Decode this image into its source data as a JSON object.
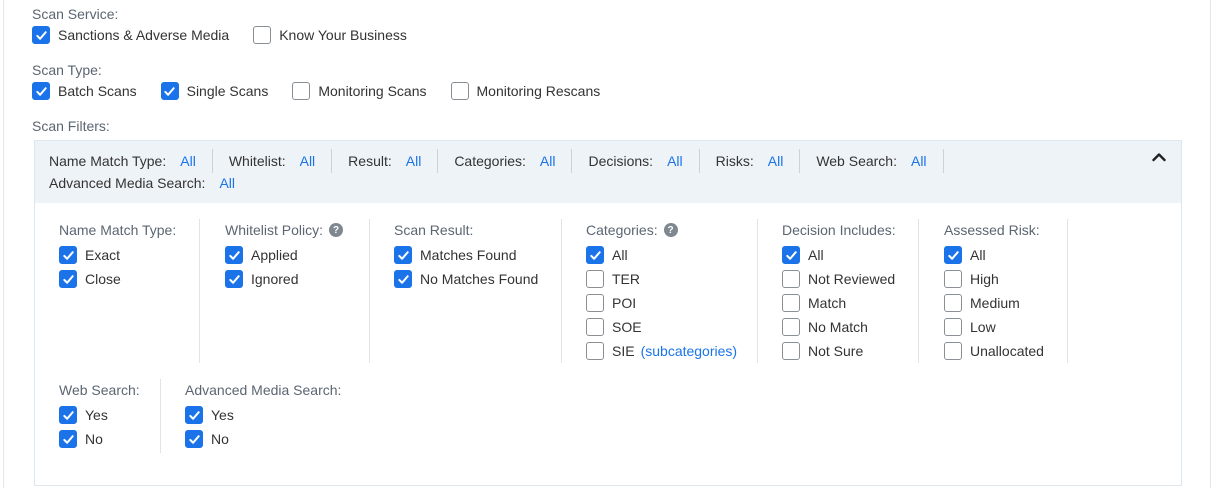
{
  "scan_service": {
    "label": "Scan Service:",
    "options": [
      {
        "label": "Sanctions & Adverse Media",
        "checked": true
      },
      {
        "label": "Know Your Business",
        "checked": false
      }
    ]
  },
  "scan_type": {
    "label": "Scan Type:",
    "options": [
      {
        "label": "Batch Scans",
        "checked": true
      },
      {
        "label": "Single Scans",
        "checked": true
      },
      {
        "label": "Monitoring Scans",
        "checked": false
      },
      {
        "label": "Monitoring Rescans",
        "checked": false
      }
    ]
  },
  "scan_filters": {
    "label": "Scan Filters:",
    "summary": [
      {
        "key": "Name Match Type:",
        "value": "All"
      },
      {
        "key": "Whitelist:",
        "value": "All"
      },
      {
        "key": "Result:",
        "value": "All"
      },
      {
        "key": "Categories:",
        "value": "All"
      },
      {
        "key": "Decisions:",
        "value": "All"
      },
      {
        "key": "Risks:",
        "value": "All"
      },
      {
        "key": "Web Search:",
        "value": "All"
      }
    ],
    "summary_line2": [
      {
        "key": "Advanced Media Search:",
        "value": "All"
      }
    ],
    "groups": {
      "name_match_type": {
        "title": "Name Match Type:",
        "options": [
          {
            "label": "Exact",
            "checked": true
          },
          {
            "label": "Close",
            "checked": true
          }
        ]
      },
      "whitelist_policy": {
        "title": "Whitelist Policy:",
        "help": "?",
        "options": [
          {
            "label": "Applied",
            "checked": true
          },
          {
            "label": "Ignored",
            "checked": true
          }
        ]
      },
      "scan_result": {
        "title": "Scan Result:",
        "options": [
          {
            "label": "Matches Found",
            "checked": true
          },
          {
            "label": "No Matches Found",
            "checked": true
          }
        ]
      },
      "categories": {
        "title": "Categories:",
        "help": "?",
        "options": [
          {
            "label": "All",
            "checked": true
          },
          {
            "label": "TER",
            "checked": false
          },
          {
            "label": "POI",
            "checked": false
          },
          {
            "label": "SOE",
            "checked": false
          },
          {
            "label": "SIE",
            "checked": false
          }
        ],
        "subcategories_link": "(subcategories)"
      },
      "decision_includes": {
        "title": "Decision Includes:",
        "options": [
          {
            "label": "All",
            "checked": true
          },
          {
            "label": "Not Reviewed",
            "checked": false
          },
          {
            "label": "Match",
            "checked": false
          },
          {
            "label": "No Match",
            "checked": false
          },
          {
            "label": "Not Sure",
            "checked": false
          }
        ]
      },
      "assessed_risk": {
        "title": "Assessed Risk:",
        "options": [
          {
            "label": "All",
            "checked": true
          },
          {
            "label": "High",
            "checked": false
          },
          {
            "label": "Medium",
            "checked": false
          },
          {
            "label": "Low",
            "checked": false
          },
          {
            "label": "Unallocated",
            "checked": false
          }
        ]
      },
      "web_search": {
        "title": "Web Search:",
        "options": [
          {
            "label": "Yes",
            "checked": true
          },
          {
            "label": "No",
            "checked": true
          }
        ]
      },
      "advanced_media_search": {
        "title": "Advanced Media Search:",
        "options": [
          {
            "label": "Yes",
            "checked": true
          },
          {
            "label": "No",
            "checked": true
          }
        ]
      }
    }
  },
  "colors": {
    "accent": "#1a73e8",
    "summary_bg": "#eef3f8",
    "label_gray": "#5b6672"
  },
  "icons": {
    "collapse": "chevron-up-icon",
    "help": "question-circle-icon",
    "check": "check-icon"
  }
}
